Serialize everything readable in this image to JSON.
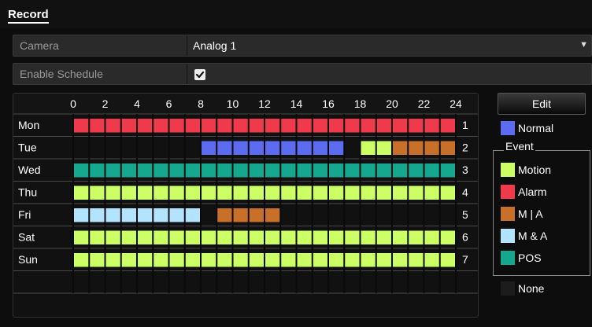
{
  "header": {
    "title": "Record"
  },
  "camera": {
    "label": "Camera",
    "value": "Analog 1"
  },
  "enable_schedule": {
    "label": "Enable Schedule",
    "checked": true
  },
  "schedule": {
    "hours": [
      "0",
      "2",
      "4",
      "6",
      "8",
      "10",
      "12",
      "14",
      "16",
      "18",
      "20",
      "22",
      "24"
    ],
    "days": [
      {
        "name": "Mon",
        "index": "1",
        "segments": [
          {
            "from": 0,
            "to": 24,
            "type": "alarm"
          }
        ]
      },
      {
        "name": "Tue",
        "index": "2",
        "segments": [
          {
            "from": 8,
            "to": 17,
            "type": "normal"
          },
          {
            "from": 18,
            "to": 20,
            "type": "motion"
          },
          {
            "from": 20,
            "to": 24,
            "type": "m_or_a"
          }
        ]
      },
      {
        "name": "Wed",
        "index": "3",
        "segments": [
          {
            "from": 0,
            "to": 24,
            "type": "pos"
          }
        ]
      },
      {
        "name": "Thu",
        "index": "4",
        "segments": [
          {
            "from": 0,
            "to": 24,
            "type": "motion"
          }
        ]
      },
      {
        "name": "Fri",
        "index": "5",
        "segments": [
          {
            "from": 0,
            "to": 8,
            "type": "m_and_a"
          },
          {
            "from": 9,
            "to": 13,
            "type": "m_or_a"
          }
        ]
      },
      {
        "name": "Sat",
        "index": "6",
        "segments": [
          {
            "from": 0,
            "to": 24,
            "type": "motion"
          }
        ]
      },
      {
        "name": "Sun",
        "index": "7",
        "segments": [
          {
            "from": 0,
            "to": 24,
            "type": "motion"
          }
        ]
      }
    ]
  },
  "colors": {
    "normal": "#5b6cf0",
    "motion": "#ccff66",
    "alarm": "#ee3a4a",
    "m_or_a": "#c8702a",
    "m_and_a": "#b3e4ff",
    "pos": "#16a88e",
    "none": "#1c1c1c"
  },
  "edit_button": {
    "label": "Edit"
  },
  "legend": {
    "normal_label": "Normal",
    "event_title": "Event",
    "motion_label": "Motion",
    "alarm_label": "Alarm",
    "m_or_a_label": "M | A",
    "m_and_a_label": "M & A",
    "pos_label": "POS",
    "none_label": "None"
  }
}
